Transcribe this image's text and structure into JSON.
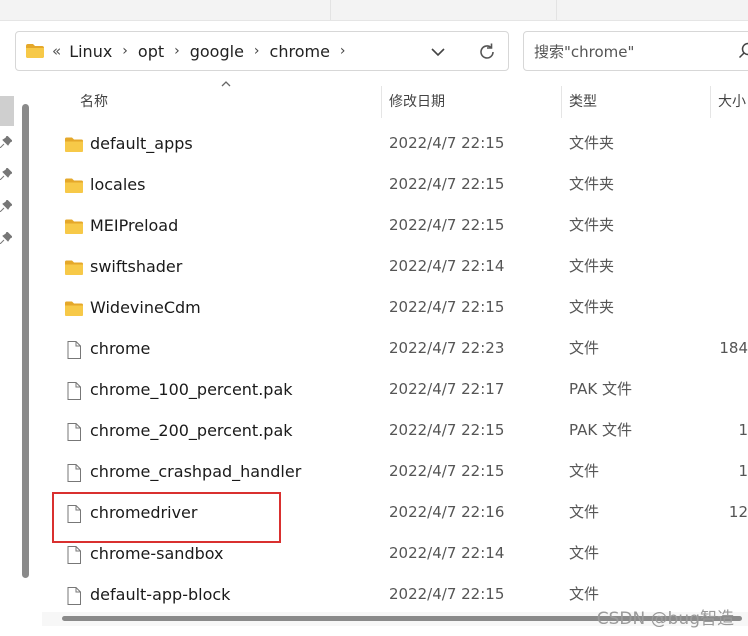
{
  "breadcrumb": {
    "overflow": "«",
    "items": [
      "Linux",
      "opt",
      "google",
      "chrome"
    ],
    "separator": "›"
  },
  "search": {
    "placeholder": "搜索\"chrome\""
  },
  "columns": {
    "name": "名称",
    "modified": "修改日期",
    "type": "类型",
    "size": "大小"
  },
  "files": [
    {
      "name": "default_apps",
      "modified": "2022/4/7 22:15",
      "type": "文件夹",
      "size": "",
      "icon": "folder-icon"
    },
    {
      "name": "locales",
      "modified": "2022/4/7 22:15",
      "type": "文件夹",
      "size": "",
      "icon": "folder-icon"
    },
    {
      "name": "MEIPreload",
      "modified": "2022/4/7 22:15",
      "type": "文件夹",
      "size": "",
      "icon": "folder-icon"
    },
    {
      "name": "swiftshader",
      "modified": "2022/4/7 22:14",
      "type": "文件夹",
      "size": "",
      "icon": "folder-icon"
    },
    {
      "name": "WidevineCdm",
      "modified": "2022/4/7 22:15",
      "type": "文件夹",
      "size": "",
      "icon": "folder-icon"
    },
    {
      "name": "chrome",
      "modified": "2022/4/7 22:23",
      "type": "文件",
      "size": "184",
      "icon": "file-icon"
    },
    {
      "name": "chrome_100_percent.pak",
      "modified": "2022/4/7 22:17",
      "type": "PAK 文件",
      "size": "",
      "icon": "file-icon"
    },
    {
      "name": "chrome_200_percent.pak",
      "modified": "2022/4/7 22:15",
      "type": "PAK 文件",
      "size": "1",
      "icon": "file-icon"
    },
    {
      "name": "chrome_crashpad_handler",
      "modified": "2022/4/7 22:15",
      "type": "文件",
      "size": "1",
      "icon": "file-icon"
    },
    {
      "name": "chromedriver",
      "modified": "2022/4/7 22:16",
      "type": "文件",
      "size": "12",
      "icon": "file-icon"
    },
    {
      "name": "chrome-sandbox",
      "modified": "2022/4/7 22:14",
      "type": "文件",
      "size": "",
      "icon": "file-icon"
    },
    {
      "name": "default-app-block",
      "modified": "2022/4/7 22:15",
      "type": "文件",
      "size": "",
      "icon": "file-icon"
    }
  ],
  "watermark": "CSDN @bug智造",
  "colors": {
    "folder": "#f7c948",
    "folder_dark": "#e5a82a",
    "highlight": "#d9302f"
  }
}
